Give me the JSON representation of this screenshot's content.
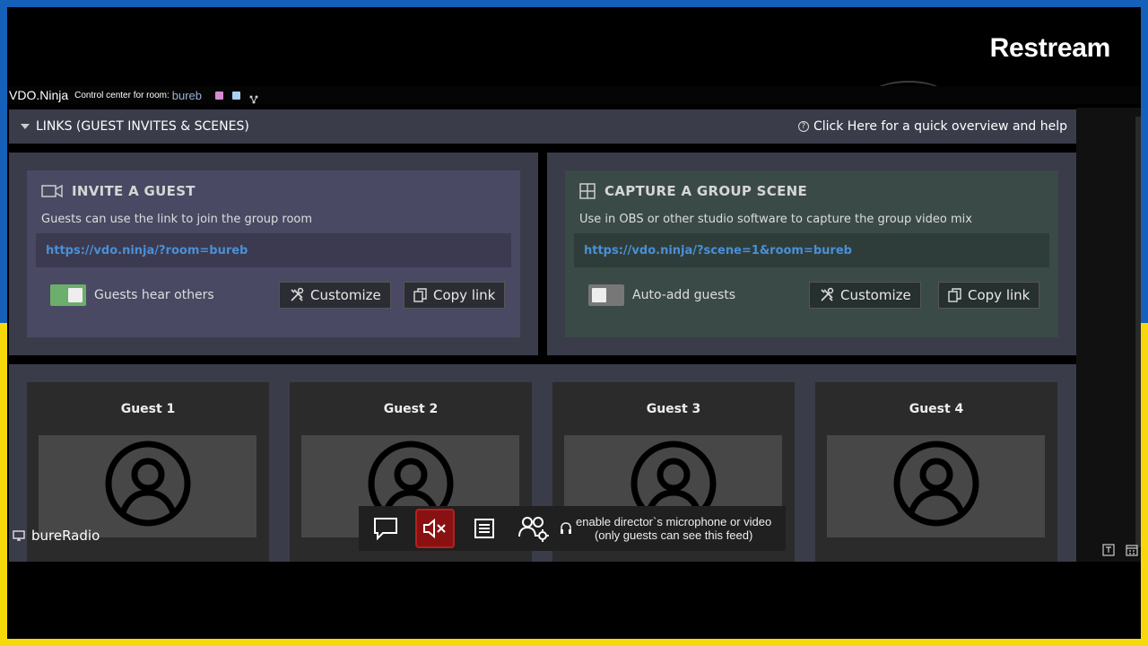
{
  "overlay": {
    "brand": "Restream"
  },
  "app": {
    "name": "VDO.Ninja",
    "caption": "Control center for room:",
    "room": "bureb"
  },
  "links_section": {
    "title": "LINKS (GUEST INVITES & SCENES)",
    "help": "Click Here for a quick overview and help"
  },
  "invite": {
    "title": "INVITE A GUEST",
    "description": "Guests can use the link to join the group room",
    "link": "https://vdo.ninja/?room=bureb",
    "toggle_label": "Guests hear others",
    "toggle_on": true,
    "customize": "Customize",
    "copy": "Copy link"
  },
  "scene": {
    "title": "CAPTURE A GROUP SCENE",
    "description": "Use in OBS or other studio software to capture the group video mix",
    "link": "https://vdo.ninja/?scene=1&room=bureb",
    "toggle_label": "Auto-add guests",
    "toggle_on": false,
    "customize": "Customize",
    "copy": "Copy link"
  },
  "guests": [
    "Guest 1",
    "Guest 2",
    "Guest 3",
    "Guest 4"
  ],
  "toolbar": {
    "director_line1": "enable director`s microphone or video",
    "director_line2": "(only guests can see this feed)"
  },
  "broadcaster": "bureRadio",
  "colors": {
    "accent_link": "#4a8fd6",
    "mute_red": "#8a1111",
    "toggle_on": "#6cae6c",
    "frame_top": "#1560b8",
    "frame_bottom": "#f7d80b"
  }
}
